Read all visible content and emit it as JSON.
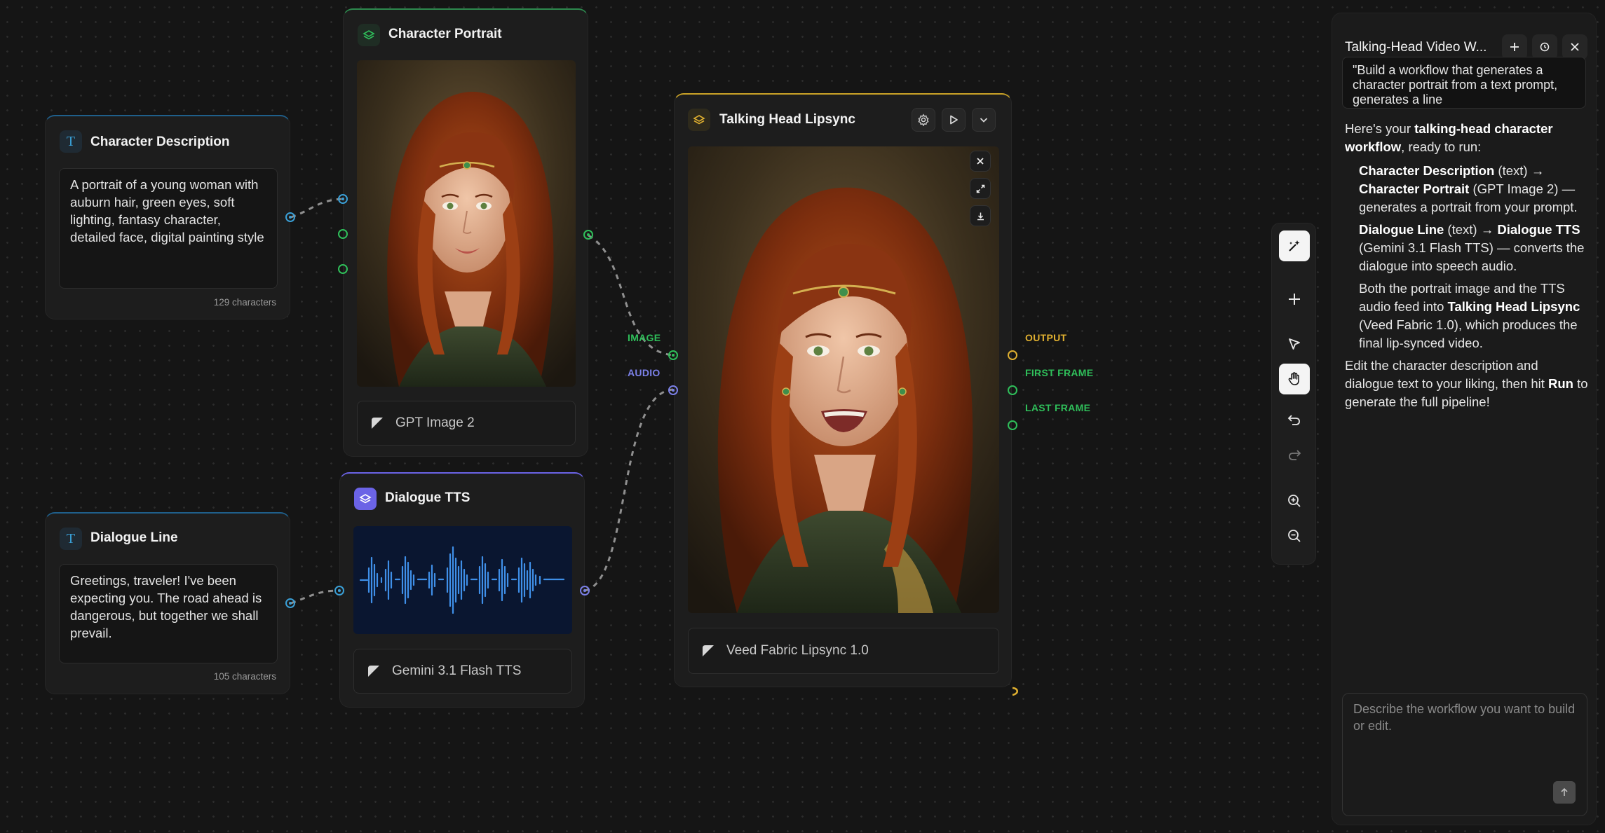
{
  "nodes": {
    "character_description": {
      "title": "Character Description",
      "text": "A portrait of a young woman with auburn hair, green eyes, soft lighting, fantasy character, detailed face, digital painting style",
      "char_count": "129 characters"
    },
    "dialogue_line": {
      "title": "Dialogue Line",
      "text": "Greetings, traveler! I've been expecting you. The road ahead is dangerous, but together we shall prevail.",
      "char_count": "105 characters"
    },
    "character_portrait": {
      "title": "Character Portrait",
      "model": "GPT Image 2"
    },
    "dialogue_tts": {
      "title": "Dialogue TTS",
      "model": "Gemini 3.1 Flash TTS"
    },
    "talking_head": {
      "title": "Talking Head Lipsync",
      "model": "Veed Fabric Lipsync 1.0",
      "inputs": {
        "image": "IMAGE",
        "audio": "AUDIO"
      },
      "outputs": {
        "output": "OUTPUT",
        "first_frame": "FIRST FRAME",
        "last_frame": "LAST FRAME"
      }
    }
  },
  "panel": {
    "title": "Talking-Head Video W...",
    "prompt_preview": "\"Build a workflow that generates a character portrait from a text prompt, generates a line",
    "response": {
      "intro_a": "Here's your ",
      "intro_b": "talking-head character workflow",
      "intro_c": ", ready to run:",
      "i1_a": "Character Description",
      "i1_b": " (text) → ",
      "i1_c": "Character Portrait",
      "i1_d": " (GPT Image 2) — generates a portrait from your prompt.",
      "i2_a": "Dialogue Line",
      "i2_b": " (text) → ",
      "i2_c": "Dialogue TTS",
      "i2_d": " (Gemini 3.1 Flash TTS) — converts the dialogue into speech audio.",
      "i3_a": "Both the portrait image and the TTS audio feed into ",
      "i3_b": "Talking Head Lipsync",
      "i3_c": " (Veed Fabric 1.0), which produces the final lip-synced video.",
      "outro_a": "Edit the character description and dialogue text to your liking, then hit ",
      "outro_b": "Run",
      "outro_c": " to generate the full pipeline!"
    },
    "input_placeholder": "Describe the workflow you want to build or edit."
  },
  "colors": {
    "canvas": "#151515",
    "text_node_accent": "#1f5f8b",
    "image_node_accent": "#2d8a4e",
    "tts_node_accent": "#6b63e6",
    "lipsync_node_accent": "#c9a227",
    "port_blue": "#3a9fd6",
    "port_green": "#2fbf5a",
    "port_purple": "#7b80e8",
    "port_gold": "#e0b030"
  },
  "icons": [
    "text-type-icon",
    "layers-icon",
    "gear-icon",
    "play-icon",
    "chevron-down-icon",
    "close-icon",
    "expand-icon",
    "download-icon",
    "magic-wand-icon",
    "plus-icon",
    "pointer-icon",
    "hand-icon",
    "undo-icon",
    "redo-icon",
    "zoom-in-icon",
    "zoom-out-icon",
    "history-icon",
    "send-arrow-icon"
  ]
}
